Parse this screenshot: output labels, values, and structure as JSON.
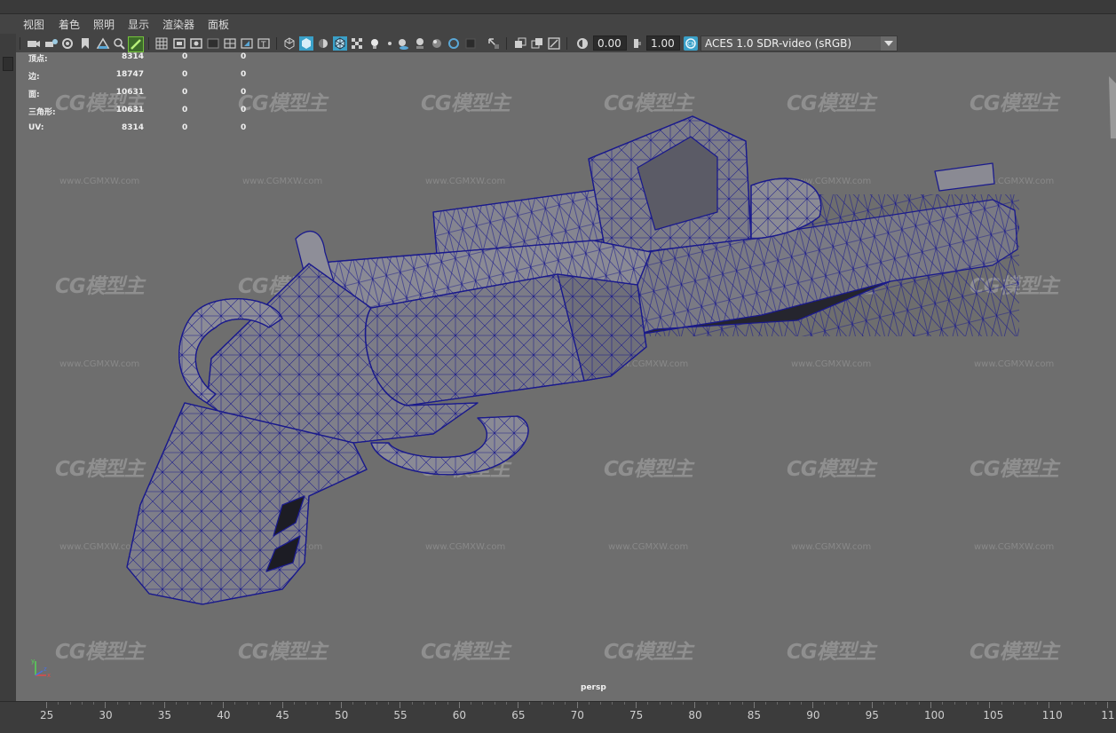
{
  "menu": {
    "items": [
      "视图",
      "着色",
      "照明",
      "显示",
      "渲染器",
      "面板"
    ]
  },
  "toolbar": {
    "exposure_value": "0.00",
    "gamma_value": "1.00",
    "color_space": "ACES 1.0 SDR-video (sRGB)",
    "icons": [
      "camera-icon",
      "camera-attributes-icon",
      "bookmark-icon",
      "image-plane-icon",
      "2d-pan-zoom-icon",
      "grease-pencil-icon",
      "grid-icon",
      "film-gate-icon",
      "resolution-gate-icon",
      "gate-mask-icon",
      "field-chart-icon",
      "safe-action-icon",
      "safe-title-icon",
      "wireframe-icon",
      "smooth-shade-icon",
      "default-material-icon",
      "wireframe-on-shaded-icon",
      "textured-icon",
      "use-lights-icon",
      "shadows-icon",
      "screen-space-ao-icon",
      "motion-blur-icon",
      "anti-aliasing-icon",
      "depth-of-field-icon",
      "isolate-select-icon",
      "xray-icon",
      "xray-joints-icon",
      "xray-active-icon",
      "exposure-icon",
      "gamma-icon",
      "color-management-icon"
    ]
  },
  "hud": {
    "rows": [
      {
        "label": "顶点:",
        "v1": "8314",
        "v2": "0",
        "v3": "0"
      },
      {
        "label": "边:",
        "v1": "18747",
        "v2": "0",
        "v3": "0"
      },
      {
        "label": "面:",
        "v1": "10631",
        "v2": "0",
        "v3": "0"
      },
      {
        "label": "三角形:",
        "v1": "10631",
        "v2": "0",
        "v3": "0"
      },
      {
        "label": "UV:",
        "v1": "8314",
        "v2": "0",
        "v3": "0"
      }
    ]
  },
  "viewport": {
    "camera_label": "persp",
    "axis": {
      "x": "x",
      "y": "y",
      "z": "z"
    }
  },
  "watermark": {
    "logo": "CG模型主",
    "url": "www.CGMXW.com"
  },
  "timeline": {
    "labels": [
      "25",
      "30",
      "35",
      "40",
      "45",
      "50",
      "55",
      "60",
      "65",
      "70",
      "75",
      "80",
      "85",
      "90",
      "95",
      "100",
      "105",
      "110",
      "11"
    ]
  },
  "colors": {
    "viewport_bg": "#6e6e6e",
    "wire": "#1a1a8c",
    "accent_active": "#3aa0c8",
    "toolbar_bg": "#444444"
  }
}
